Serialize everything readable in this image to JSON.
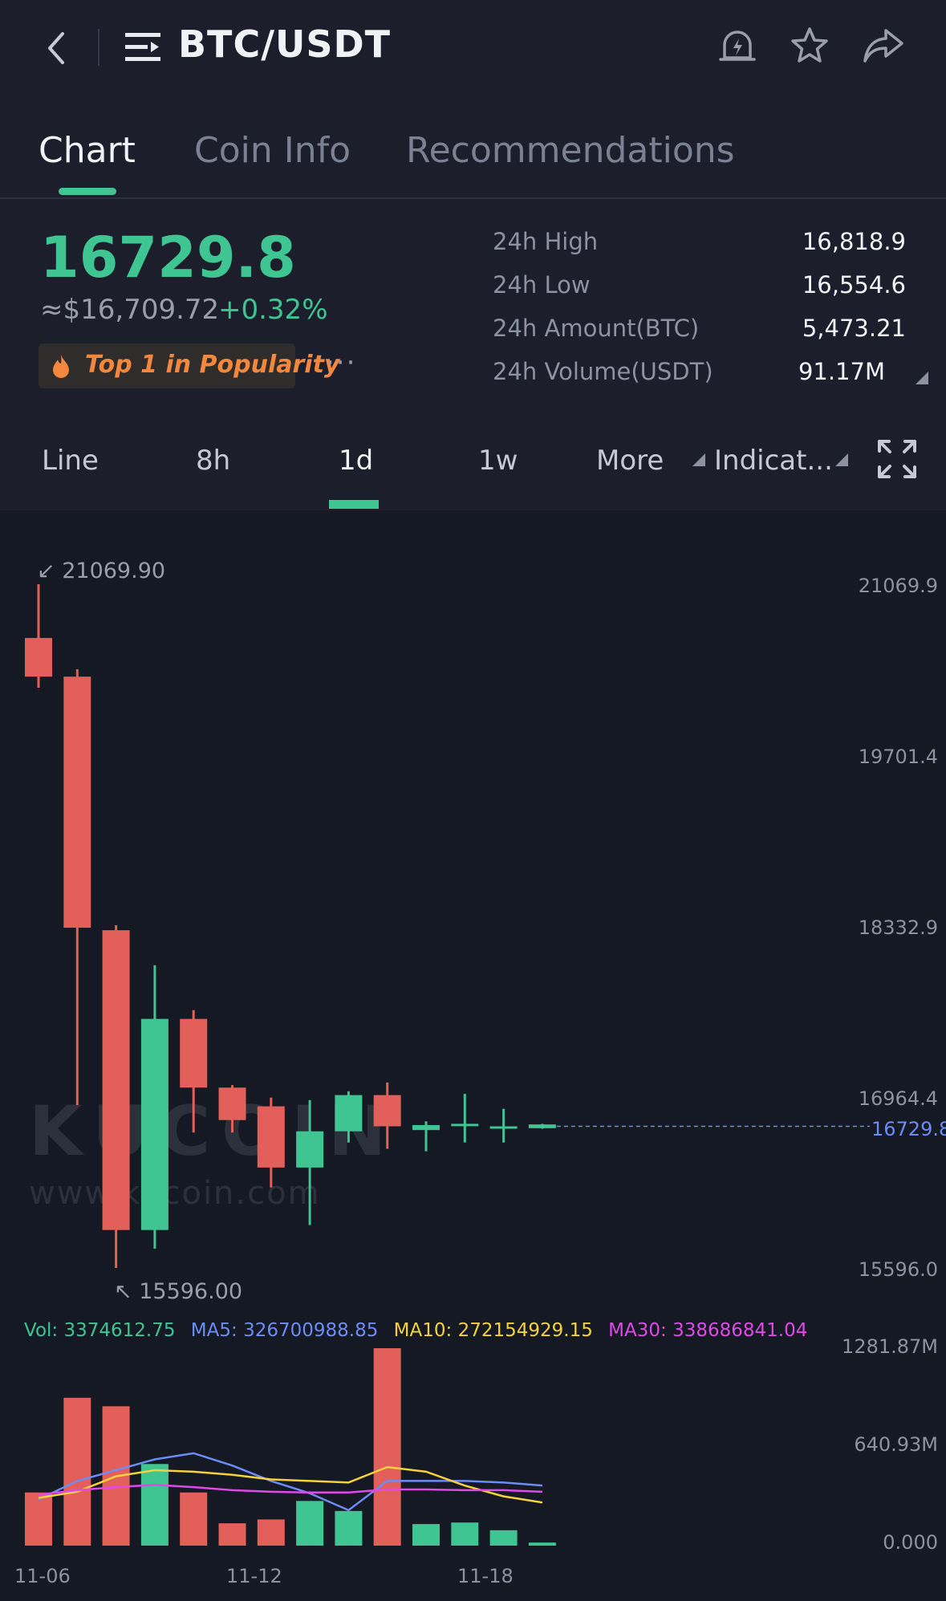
{
  "header": {
    "title": "BTC/USDT"
  },
  "tabs": [
    {
      "label": "Chart",
      "active": true
    },
    {
      "label": "Coin Info",
      "active": false
    },
    {
      "label": "Recommendations",
      "active": false
    }
  ],
  "ticker": {
    "last_price": "16729.8",
    "usd_equivalent": "≈$16,709.72",
    "change_pct": "+0.32%",
    "popularity_badge": "Top 1 in Popularity",
    "more_dots": "···",
    "stats": [
      {
        "label": "24h High",
        "value": "16,818.9"
      },
      {
        "label": "24h Low",
        "value": "16,554.6"
      },
      {
        "label": "24h Amount(BTC)",
        "value": "5,473.21"
      },
      {
        "label": "24h Volume(USDT)",
        "value": "91.17M"
      }
    ]
  },
  "ranges": {
    "line": "Line",
    "h8": "8h",
    "d1": "1d",
    "w1": "1w",
    "more": "More",
    "indicators": "Indicat...",
    "active": "1d"
  },
  "colors": {
    "up": "#3ec592",
    "down": "#e35f5a",
    "ma5": "#6c8cf5",
    "ma10": "#f5d23a",
    "ma30": "#e048e8",
    "last_price_line": "#6c8cf5"
  },
  "chart": {
    "max_marker": "21069.90",
    "min_marker": "15596.00",
    "last_price_tag": "16729.8",
    "price_axis": [
      "21069.9",
      "19701.4",
      "18332.9",
      "16964.4",
      "15596.0"
    ],
    "volume_axis": [
      "1281.87M",
      "640.93M",
      "0.000"
    ],
    "dates": [
      "11-06",
      "11-12",
      "11-18"
    ],
    "legend": {
      "vol": "Vol: 3374612.75",
      "ma5": "MA5: 326700988.85",
      "ma10": "MA10: 272154929.15",
      "ma30": "MA30: 338686841.04"
    },
    "watermark_logo": "KUCOIN",
    "watermark_url": "www.kucoin.com"
  },
  "chart_data": {
    "type": "candlestick",
    "ylim": [
      15596.0,
      21069.9
    ],
    "volume_ylim": [
      0,
      1281.87
    ],
    "volume_unit": "M",
    "candles": [
      {
        "open": 20640,
        "high": 21069.9,
        "low": 20240,
        "close": 20330
      },
      {
        "open": 20330,
        "high": 20390,
        "low": 16900,
        "close": 18320
      },
      {
        "open": 18300,
        "high": 18340,
        "low": 15596.0,
        "close": 15900
      },
      {
        "open": 15900,
        "high": 18020,
        "low": 15750,
        "close": 17590
      },
      {
        "open": 17590,
        "high": 17660,
        "low": 16680,
        "close": 17040
      },
      {
        "open": 17040,
        "high": 17060,
        "low": 16680,
        "close": 16780
      },
      {
        "open": 16890,
        "high": 16960,
        "low": 16240,
        "close": 16400
      },
      {
        "open": 16400,
        "high": 16940,
        "low": 15940,
        "close": 16690
      },
      {
        "open": 16690,
        "high": 17010,
        "low": 16600,
        "close": 16980
      },
      {
        "open": 16980,
        "high": 17080,
        "low": 16550,
        "close": 16730
      },
      {
        "open": 16700,
        "high": 16770,
        "low": 16530,
        "close": 16740
      },
      {
        "open": 16740,
        "high": 16990,
        "low": 16600,
        "close": 16750
      },
      {
        "open": 16720,
        "high": 16870,
        "low": 16600,
        "close": 16730
      },
      {
        "open": 16715,
        "high": 16750,
        "low": 16710,
        "close": 16745
      }
    ],
    "volumes": [
      345,
      960,
      905,
      530,
      345,
      145,
      170,
      290,
      225,
      1281.87,
      140,
      150,
      100,
      20
    ],
    "ma5_volume": [
      300,
      420,
      490,
      560,
      600,
      520,
      420,
      340,
      230,
      420,
      420,
      420,
      410,
      390
    ],
    "ma10_volume": [
      310,
      350,
      450,
      490,
      480,
      460,
      430,
      420,
      410,
      510,
      480,
      390,
      320,
      280
    ],
    "ma30_volume": [
      330,
      360,
      380,
      395,
      380,
      360,
      350,
      345,
      345,
      365,
      365,
      360,
      360,
      350
    ]
  }
}
